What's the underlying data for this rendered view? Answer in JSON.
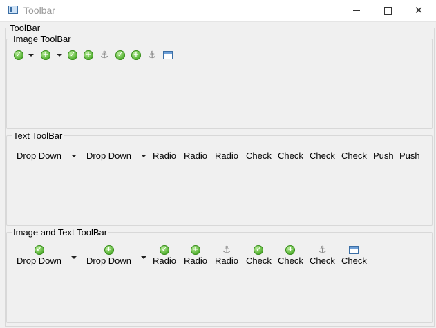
{
  "window": {
    "title": "Toolbar",
    "minimize_glyph": "",
    "maximize_glyph": "",
    "close_glyph": "✕"
  },
  "outer_group_title": "ToolBar",
  "image_toolbar": {
    "title": "Image ToolBar",
    "items": [
      {
        "icon": "check-icon",
        "dropdown": true
      },
      {
        "icon": "plus-icon",
        "dropdown": true
      },
      {
        "icon": "check-icon"
      },
      {
        "icon": "plus-icon"
      },
      {
        "icon": "anchor-icon"
      },
      {
        "icon": "check-icon"
      },
      {
        "icon": "plus-icon"
      },
      {
        "icon": "anchor-icon"
      },
      {
        "icon": "window-icon"
      }
    ]
  },
  "text_toolbar": {
    "title": "Text ToolBar",
    "items": [
      "Drop Down",
      "Drop Down",
      "Radio",
      "Radio",
      "Radio",
      "Check",
      "Check",
      "Check",
      "Check",
      "Push",
      "Push"
    ]
  },
  "image_text_toolbar": {
    "title": "Image and Text ToolBar",
    "items": [
      {
        "label": "Drop Down",
        "icon": "check-icon",
        "dropdown": true
      },
      {
        "label": "Drop Down",
        "icon": "plus-icon",
        "dropdown": true
      },
      {
        "label": "Radio",
        "icon": "check-icon"
      },
      {
        "label": "Radio",
        "icon": "plus-icon"
      },
      {
        "label": "Radio",
        "icon": "anchor-icon"
      },
      {
        "label": "Check",
        "icon": "check-icon"
      },
      {
        "label": "Check",
        "icon": "plus-icon"
      },
      {
        "label": "Check",
        "icon": "anchor-icon"
      },
      {
        "label": "Check",
        "icon": "window-icon"
      }
    ]
  },
  "glyphs": {
    "check": "✓",
    "plus": "+",
    "anchor": "⚓"
  }
}
